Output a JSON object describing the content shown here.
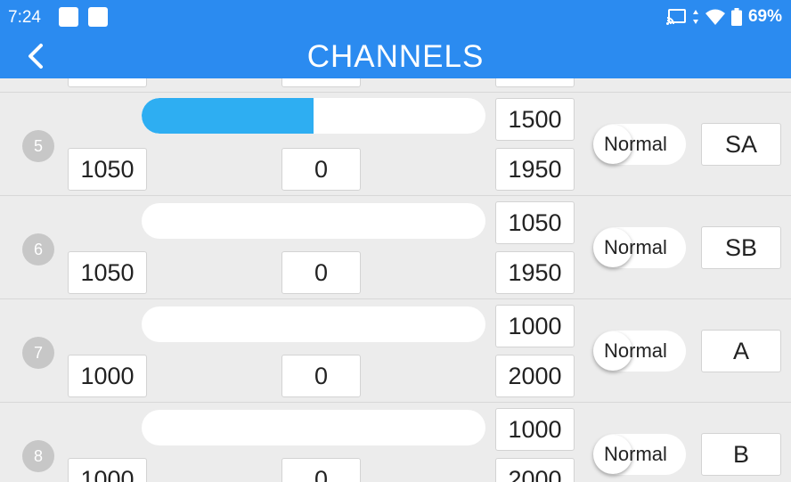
{
  "status_bar": {
    "time": "7:24",
    "battery": "69%",
    "icons": [
      "notification-square-icon",
      "notification-square-icon",
      "cast-icon",
      "data-arrows-icon",
      "wifi-icon",
      "battery-icon"
    ]
  },
  "header": {
    "title": "CHANNELS",
    "back_icon": "chevron-left-icon"
  },
  "colors": {
    "accent": "#2b8bf0",
    "bar_fill": "#2eaef2",
    "background": "#ececec"
  },
  "channels": [
    {
      "number": "5",
      "bar_fill_percent": 50,
      "min": "1050",
      "subtrim": "0",
      "value": "1500",
      "max": "1950",
      "reverse": "Normal",
      "switch": "SA"
    },
    {
      "number": "6",
      "bar_fill_percent": 0,
      "min": "1050",
      "subtrim": "0",
      "value": "1050",
      "max": "1950",
      "reverse": "Normal",
      "switch": "SB"
    },
    {
      "number": "7",
      "bar_fill_percent": 0,
      "min": "1000",
      "subtrim": "0",
      "value": "1000",
      "max": "2000",
      "reverse": "Normal",
      "switch": "A"
    },
    {
      "number": "8",
      "bar_fill_percent": 0,
      "min": "1000",
      "subtrim": "0",
      "value": "1000",
      "max": "2000",
      "reverse": "Normal",
      "switch": "B"
    }
  ]
}
